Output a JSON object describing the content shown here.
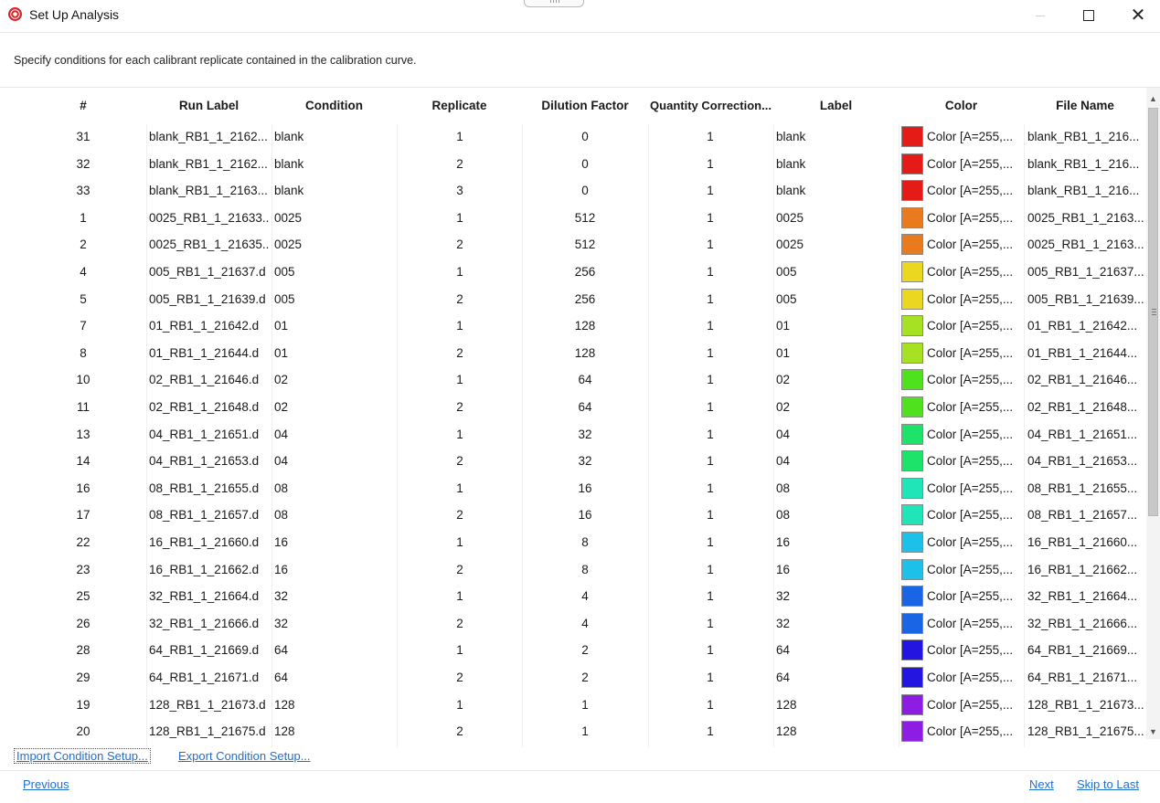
{
  "window": {
    "title": "Set Up Analysis"
  },
  "instruction": "Specify conditions for each calibrant replicate contained in the calibration curve.",
  "grid": {
    "columns": [
      "#",
      "Run Label",
      "Condition",
      "Replicate",
      "Dilution Factor",
      "Quantity Correction...",
      "Label",
      "Color",
      "File Name"
    ],
    "rows": [
      {
        "num": "31",
        "run": "blank_RB1_1_2162...",
        "cond": "blank",
        "rep": "1",
        "dil": "0",
        "qc": "1",
        "label": "blank",
        "color_hex": "#e41b17",
        "color_text": "Color [A=255,...",
        "file": "blank_RB1_1_216..."
      },
      {
        "num": "32",
        "run": "blank_RB1_1_2162...",
        "cond": "blank",
        "rep": "2",
        "dil": "0",
        "qc": "1",
        "label": "blank",
        "color_hex": "#e41b17",
        "color_text": "Color [A=255,...",
        "file": "blank_RB1_1_216..."
      },
      {
        "num": "33",
        "run": "blank_RB1_1_2163...",
        "cond": "blank",
        "rep": "3",
        "dil": "0",
        "qc": "1",
        "label": "blank",
        "color_hex": "#e41b17",
        "color_text": "Color [A=255,...",
        "file": "blank_RB1_1_216..."
      },
      {
        "num": "1",
        "run": "0025_RB1_1_21633...",
        "cond": "0025",
        "rep": "1",
        "dil": "512",
        "qc": "1",
        "label": "0025",
        "color_hex": "#ea7a1e",
        "color_text": "Color [A=255,...",
        "file": "0025_RB1_1_2163..."
      },
      {
        "num": "2",
        "run": "0025_RB1_1_21635...",
        "cond": "0025",
        "rep": "2",
        "dil": "512",
        "qc": "1",
        "label": "0025",
        "color_hex": "#ea7a1e",
        "color_text": "Color [A=255,...",
        "file": "0025_RB1_1_2163..."
      },
      {
        "num": "4",
        "run": "005_RB1_1_21637.d",
        "cond": "005",
        "rep": "1",
        "dil": "256",
        "qc": "1",
        "label": "005",
        "color_hex": "#ecd720",
        "color_text": "Color [A=255,...",
        "file": "005_RB1_1_21637..."
      },
      {
        "num": "5",
        "run": "005_RB1_1_21639.d",
        "cond": "005",
        "rep": "2",
        "dil": "256",
        "qc": "1",
        "label": "005",
        "color_hex": "#ecd720",
        "color_text": "Color [A=255,...",
        "file": "005_RB1_1_21639..."
      },
      {
        "num": "7",
        "run": "01_RB1_1_21642.d",
        "cond": "01",
        "rep": "1",
        "dil": "128",
        "qc": "1",
        "label": "01",
        "color_hex": "#a6e123",
        "color_text": "Color [A=255,...",
        "file": "01_RB1_1_21642..."
      },
      {
        "num": "8",
        "run": "01_RB1_1_21644.d",
        "cond": "01",
        "rep": "2",
        "dil": "128",
        "qc": "1",
        "label": "01",
        "color_hex": "#a6e123",
        "color_text": "Color [A=255,...",
        "file": "01_RB1_1_21644..."
      },
      {
        "num": "10",
        "run": "02_RB1_1_21646.d",
        "cond": "02",
        "rep": "1",
        "dil": "64",
        "qc": "1",
        "label": "02",
        "color_hex": "#4fe01e",
        "color_text": "Color [A=255,...",
        "file": "02_RB1_1_21646..."
      },
      {
        "num": "11",
        "run": "02_RB1_1_21648.d",
        "cond": "02",
        "rep": "2",
        "dil": "64",
        "qc": "1",
        "label": "02",
        "color_hex": "#4fe01e",
        "color_text": "Color [A=255,...",
        "file": "02_RB1_1_21648..."
      },
      {
        "num": "13",
        "run": "04_RB1_1_21651.d",
        "cond": "04",
        "rep": "1",
        "dil": "32",
        "qc": "1",
        "label": "04",
        "color_hex": "#1de36a",
        "color_text": "Color [A=255,...",
        "file": "04_RB1_1_21651..."
      },
      {
        "num": "14",
        "run": "04_RB1_1_21653.d",
        "cond": "04",
        "rep": "2",
        "dil": "32",
        "qc": "1",
        "label": "04",
        "color_hex": "#1de36a",
        "color_text": "Color [A=255,...",
        "file": "04_RB1_1_21653..."
      },
      {
        "num": "16",
        "run": "08_RB1_1_21655.d",
        "cond": "08",
        "rep": "1",
        "dil": "16",
        "qc": "1",
        "label": "08",
        "color_hex": "#1fe5b8",
        "color_text": "Color [A=255,...",
        "file": "08_RB1_1_21655..."
      },
      {
        "num": "17",
        "run": "08_RB1_1_21657.d",
        "cond": "08",
        "rep": "2",
        "dil": "16",
        "qc": "1",
        "label": "08",
        "color_hex": "#1fe5b8",
        "color_text": "Color [A=255,...",
        "file": "08_RB1_1_21657..."
      },
      {
        "num": "22",
        "run": "16_RB1_1_21660.d",
        "cond": "16",
        "rep": "1",
        "dil": "8",
        "qc": "1",
        "label": "16",
        "color_hex": "#1cc0e8",
        "color_text": "Color [A=255,...",
        "file": "16_RB1_1_21660..."
      },
      {
        "num": "23",
        "run": "16_RB1_1_21662.d",
        "cond": "16",
        "rep": "2",
        "dil": "8",
        "qc": "1",
        "label": "16",
        "color_hex": "#1cc0e8",
        "color_text": "Color [A=255,...",
        "file": "16_RB1_1_21662..."
      },
      {
        "num": "25",
        "run": "32_RB1_1_21664.d",
        "cond": "32",
        "rep": "1",
        "dil": "4",
        "qc": "1",
        "label": "32",
        "color_hex": "#1a64e6",
        "color_text": "Color [A=255,...",
        "file": "32_RB1_1_21664..."
      },
      {
        "num": "26",
        "run": "32_RB1_1_21666.d",
        "cond": "32",
        "rep": "2",
        "dil": "4",
        "qc": "1",
        "label": "32",
        "color_hex": "#1a64e6",
        "color_text": "Color [A=255,...",
        "file": "32_RB1_1_21666..."
      },
      {
        "num": "28",
        "run": "64_RB1_1_21669.d",
        "cond": "64",
        "rep": "1",
        "dil": "2",
        "qc": "1",
        "label": "64",
        "color_hex": "#2415e0",
        "color_text": "Color [A=255,...",
        "file": "64_RB1_1_21669..."
      },
      {
        "num": "29",
        "run": "64_RB1_1_21671.d",
        "cond": "64",
        "rep": "2",
        "dil": "2",
        "qc": "1",
        "label": "64",
        "color_hex": "#2415e0",
        "color_text": "Color [A=255,...",
        "file": "64_RB1_1_21671..."
      },
      {
        "num": "19",
        "run": "128_RB1_1_21673.d",
        "cond": "128",
        "rep": "1",
        "dil": "1",
        "qc": "1",
        "label": "128",
        "color_hex": "#8e1de3",
        "color_text": "Color [A=255,...",
        "file": "128_RB1_1_21673..."
      },
      {
        "num": "20",
        "run": "128_RB1_1_21675.d",
        "cond": "128",
        "rep": "2",
        "dil": "1",
        "qc": "1",
        "label": "128",
        "color_hex": "#8e1de3",
        "color_text": "Color [A=255,...",
        "file": "128_RB1_1_21675..."
      }
    ]
  },
  "actions": {
    "import_label": "Import Condition Setup...",
    "export_label": "Export Condition Setup..."
  },
  "nav": {
    "previous_label": "Previous",
    "next_label": "Next",
    "skip_label": "Skip to Last"
  },
  "colors": {
    "link": "#1f6fd1"
  }
}
